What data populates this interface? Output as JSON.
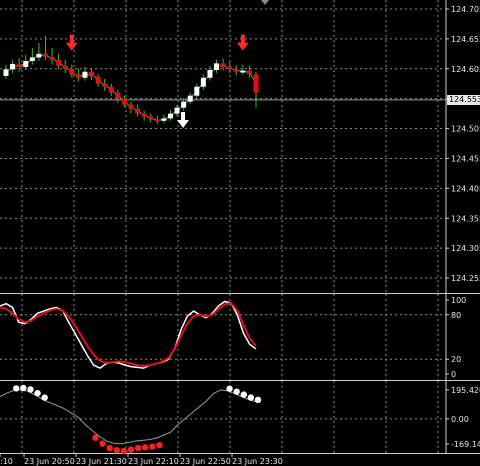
{
  "colors": {
    "background": "#000000",
    "grid": "#8c8c8c",
    "axis": "#cfcfcf",
    "bull_candle": "#ffffff",
    "bear_candle": "#e01010",
    "wick": "#3db83d",
    "stoch_main": "#ffffff",
    "stoch_signal": "#e01010",
    "cci_line": "#9a9a9a",
    "dot_white": "#ffffff",
    "dot_red": "#ff2020",
    "arrow_red": "#ff2a2a",
    "arrow_white": "#ffffff"
  },
  "price_axis": {
    "labels": [
      "124.705",
      "124.655",
      "124.605",
      "124.555",
      "124.505",
      "124.455",
      "124.405",
      "124.355",
      "124.305",
      "124.255"
    ],
    "current_price": "124.553"
  },
  "stoch_axis": {
    "labels": [
      "100",
      "80",
      "20",
      "0"
    ]
  },
  "cci_axis": {
    "labels": [
      "195.4203",
      "0.00",
      "-169.1482"
    ]
  },
  "time_axis": {
    "labels": [
      ":10",
      "23 Jun 20:50",
      "23 Jun 21:30",
      "23 Jun 22:10",
      "23 Jun 22:50",
      "23 Jun 23:30"
    ]
  },
  "chart_data": [
    {
      "type": "candlestick",
      "ylim": [
        124.23,
        124.72
      ],
      "current_price": 124.553,
      "candles": [
        {
          "o": 124.593,
          "c": 124.604,
          "h": 124.612,
          "l": 124.588
        },
        {
          "o": 124.604,
          "c": 124.613,
          "h": 124.62,
          "l": 124.598
        },
        {
          "o": 124.613,
          "c": 124.608,
          "h": 124.623,
          "l": 124.6
        },
        {
          "o": 124.608,
          "c": 124.618,
          "h": 124.628,
          "l": 124.603
        },
        {
          "o": 124.618,
          "c": 124.624,
          "h": 124.64,
          "l": 124.612
        },
        {
          "o": 124.624,
          "c": 124.63,
          "h": 124.648,
          "l": 124.618
        },
        {
          "o": 124.63,
          "c": 124.625,
          "h": 124.66,
          "l": 124.62
        },
        {
          "o": 124.625,
          "c": 124.62,
          "h": 124.64,
          "l": 124.612
        },
        {
          "o": 124.62,
          "c": 124.61,
          "h": 124.63,
          "l": 124.604
        },
        {
          "o": 124.61,
          "c": 124.605,
          "h": 124.62,
          "l": 124.598
        },
        {
          "o": 124.605,
          "c": 124.595,
          "h": 124.612,
          "l": 124.59
        },
        {
          "o": 124.595,
          "c": 124.59,
          "h": 124.606,
          "l": 124.584
        },
        {
          "o": 124.59,
          "c": 124.6,
          "h": 124.608,
          "l": 124.585
        },
        {
          "o": 124.6,
          "c": 124.592,
          "h": 124.605,
          "l": 124.586
        },
        {
          "o": 124.592,
          "c": 124.58,
          "h": 124.596,
          "l": 124.575
        },
        {
          "o": 124.58,
          "c": 124.575,
          "h": 124.588,
          "l": 124.568
        },
        {
          "o": 124.575,
          "c": 124.565,
          "h": 124.58,
          "l": 124.56
        },
        {
          "o": 124.565,
          "c": 124.555,
          "h": 124.57,
          "l": 124.548
        },
        {
          "o": 124.555,
          "c": 124.545,
          "h": 124.56,
          "l": 124.54
        },
        {
          "o": 124.545,
          "c": 124.538,
          "h": 124.55,
          "l": 124.53
        },
        {
          "o": 124.538,
          "c": 124.53,
          "h": 124.545,
          "l": 124.525
        },
        {
          "o": 124.53,
          "c": 124.525,
          "h": 124.535,
          "l": 124.518
        },
        {
          "o": 124.525,
          "c": 124.52,
          "h": 124.53,
          "l": 124.515
        },
        {
          "o": 124.52,
          "c": 124.518,
          "h": 124.527,
          "l": 124.513
        },
        {
          "o": 124.518,
          "c": 124.522,
          "h": 124.528,
          "l": 124.514
        },
        {
          "o": 124.522,
          "c": 124.53,
          "h": 124.536,
          "l": 124.518
        },
        {
          "o": 124.53,
          "c": 124.54,
          "h": 124.545,
          "l": 124.526
        },
        {
          "o": 124.54,
          "c": 124.55,
          "h": 124.556,
          "l": 124.535
        },
        {
          "o": 124.55,
          "c": 124.56,
          "h": 124.565,
          "l": 124.546
        },
        {
          "o": 124.56,
          "c": 124.575,
          "h": 124.58,
          "l": 124.555
        },
        {
          "o": 124.575,
          "c": 124.59,
          "h": 124.596,
          "l": 124.57
        },
        {
          "o": 124.59,
          "c": 124.603,
          "h": 124.61,
          "l": 124.585
        },
        {
          "o": 124.603,
          "c": 124.614,
          "h": 124.62,
          "l": 124.598
        },
        {
          "o": 124.614,
          "c": 124.608,
          "h": 124.622,
          "l": 124.602
        },
        {
          "o": 124.608,
          "c": 124.604,
          "h": 124.616,
          "l": 124.598
        },
        {
          "o": 124.604,
          "c": 124.6,
          "h": 124.611,
          "l": 124.594
        },
        {
          "o": 124.6,
          "c": 124.602,
          "h": 124.612,
          "l": 124.595
        },
        {
          "o": 124.602,
          "c": 124.596,
          "h": 124.61,
          "l": 124.59
        },
        {
          "o": 124.596,
          "c": 124.565,
          "h": 124.6,
          "l": 124.54
        }
      ],
      "down_arrows": [
        10,
        36
      ],
      "up_arrows": [
        26
      ]
    },
    {
      "type": "line",
      "ylim": [
        0,
        100
      ],
      "series": [
        {
          "values": [
            92,
            95,
            90,
            70,
            68,
            74,
            82,
            85,
            88,
            90,
            86,
            70,
            55,
            40,
            25,
            12,
            8,
            14,
            16,
            15,
            12,
            10,
            9,
            8,
            12,
            14,
            16,
            20,
            35,
            60,
            78,
            85,
            80,
            76,
            82,
            92,
            98,
            96,
            80,
            55,
            40,
            34
          ]
        },
        {
          "values": [
            90,
            88,
            82,
            74,
            70,
            72,
            78,
            82,
            86,
            88,
            86,
            78,
            66,
            52,
            38,
            26,
            18,
            15,
            16,
            17,
            16,
            14,
            12,
            11,
            12,
            14,
            17,
            22,
            34,
            52,
            68,
            78,
            80,
            78,
            80,
            88,
            94,
            96,
            86,
            66,
            48,
            38
          ]
        }
      ]
    },
    {
      "type": "line",
      "ylim": [
        -190,
        215
      ],
      "series": [
        {
          "values": [
            150,
            175,
            192,
            195,
            185,
            160,
            130,
            110,
            90,
            70,
            40,
            10,
            -40,
            -80,
            -120,
            -150,
            -165,
            -169,
            -160,
            -150,
            -145,
            -140,
            -130,
            -110,
            -90,
            -40,
            0,
            40,
            80,
            120,
            170,
            195,
            190,
            170,
            150,
            130,
            115
          ]
        }
      ],
      "white_dots": [
        2,
        3,
        4,
        5,
        6,
        32,
        33,
        34,
        35,
        36
      ],
      "red_dots": [
        13,
        14,
        15,
        16,
        17,
        18,
        19,
        20,
        21,
        22
      ]
    }
  ]
}
